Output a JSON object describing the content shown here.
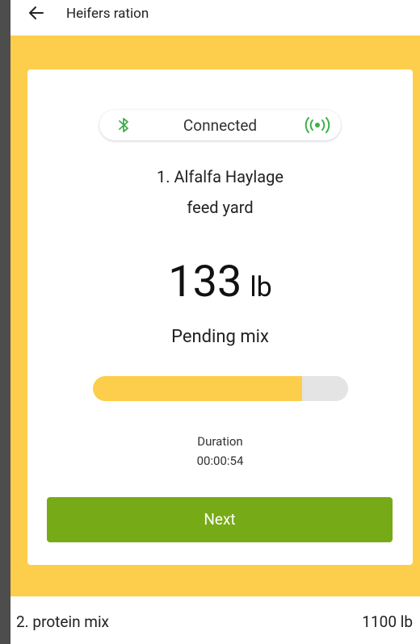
{
  "header": {
    "title": "Heifers ration",
    "back_icon": "arrow-left-icon"
  },
  "connection": {
    "status": "Connected",
    "bluetooth_icon": "bluetooth-icon",
    "signal_icon": "broadcast-signal-icon",
    "color": "#3fae49"
  },
  "current_item": {
    "name": "1. Alfalfa Haylage",
    "location": "feed yard",
    "weight_value": "133",
    "weight_unit": "lb",
    "status": "Pending mix",
    "progress_fraction": 0.82,
    "duration_label": "Duration",
    "duration_value": "00:00:54"
  },
  "actions": {
    "next_label": "Next"
  },
  "next_item": {
    "name": "2. protein mix",
    "amount": "1100 lb"
  },
  "colors": {
    "accent_yellow": "#fdcd4c",
    "button_green": "#77aa17",
    "progress_track": "#e4e4e4"
  }
}
